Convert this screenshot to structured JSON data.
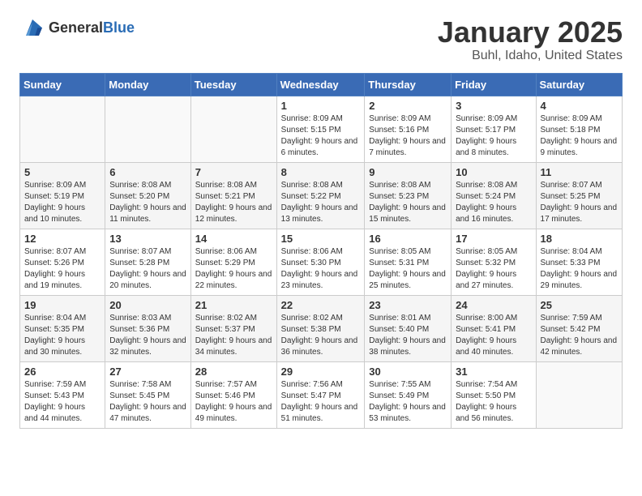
{
  "logo": {
    "general": "General",
    "blue": "Blue"
  },
  "header": {
    "month": "January 2025",
    "location": "Buhl, Idaho, United States"
  },
  "weekdays": [
    "Sunday",
    "Monday",
    "Tuesday",
    "Wednesday",
    "Thursday",
    "Friday",
    "Saturday"
  ],
  "weeks": [
    [
      {
        "day": "",
        "info": ""
      },
      {
        "day": "",
        "info": ""
      },
      {
        "day": "",
        "info": ""
      },
      {
        "day": "1",
        "info": "Sunrise: 8:09 AM\nSunset: 5:15 PM\nDaylight: 9 hours and 6 minutes."
      },
      {
        "day": "2",
        "info": "Sunrise: 8:09 AM\nSunset: 5:16 PM\nDaylight: 9 hours and 7 minutes."
      },
      {
        "day": "3",
        "info": "Sunrise: 8:09 AM\nSunset: 5:17 PM\nDaylight: 9 hours and 8 minutes."
      },
      {
        "day": "4",
        "info": "Sunrise: 8:09 AM\nSunset: 5:18 PM\nDaylight: 9 hours and 9 minutes."
      }
    ],
    [
      {
        "day": "5",
        "info": "Sunrise: 8:09 AM\nSunset: 5:19 PM\nDaylight: 9 hours and 10 minutes."
      },
      {
        "day": "6",
        "info": "Sunrise: 8:08 AM\nSunset: 5:20 PM\nDaylight: 9 hours and 11 minutes."
      },
      {
        "day": "7",
        "info": "Sunrise: 8:08 AM\nSunset: 5:21 PM\nDaylight: 9 hours and 12 minutes."
      },
      {
        "day": "8",
        "info": "Sunrise: 8:08 AM\nSunset: 5:22 PM\nDaylight: 9 hours and 13 minutes."
      },
      {
        "day": "9",
        "info": "Sunrise: 8:08 AM\nSunset: 5:23 PM\nDaylight: 9 hours and 15 minutes."
      },
      {
        "day": "10",
        "info": "Sunrise: 8:08 AM\nSunset: 5:24 PM\nDaylight: 9 hours and 16 minutes."
      },
      {
        "day": "11",
        "info": "Sunrise: 8:07 AM\nSunset: 5:25 PM\nDaylight: 9 hours and 17 minutes."
      }
    ],
    [
      {
        "day": "12",
        "info": "Sunrise: 8:07 AM\nSunset: 5:26 PM\nDaylight: 9 hours and 19 minutes."
      },
      {
        "day": "13",
        "info": "Sunrise: 8:07 AM\nSunset: 5:28 PM\nDaylight: 9 hours and 20 minutes."
      },
      {
        "day": "14",
        "info": "Sunrise: 8:06 AM\nSunset: 5:29 PM\nDaylight: 9 hours and 22 minutes."
      },
      {
        "day": "15",
        "info": "Sunrise: 8:06 AM\nSunset: 5:30 PM\nDaylight: 9 hours and 23 minutes."
      },
      {
        "day": "16",
        "info": "Sunrise: 8:05 AM\nSunset: 5:31 PM\nDaylight: 9 hours and 25 minutes."
      },
      {
        "day": "17",
        "info": "Sunrise: 8:05 AM\nSunset: 5:32 PM\nDaylight: 9 hours and 27 minutes."
      },
      {
        "day": "18",
        "info": "Sunrise: 8:04 AM\nSunset: 5:33 PM\nDaylight: 9 hours and 29 minutes."
      }
    ],
    [
      {
        "day": "19",
        "info": "Sunrise: 8:04 AM\nSunset: 5:35 PM\nDaylight: 9 hours and 30 minutes."
      },
      {
        "day": "20",
        "info": "Sunrise: 8:03 AM\nSunset: 5:36 PM\nDaylight: 9 hours and 32 minutes."
      },
      {
        "day": "21",
        "info": "Sunrise: 8:02 AM\nSunset: 5:37 PM\nDaylight: 9 hours and 34 minutes."
      },
      {
        "day": "22",
        "info": "Sunrise: 8:02 AM\nSunset: 5:38 PM\nDaylight: 9 hours and 36 minutes."
      },
      {
        "day": "23",
        "info": "Sunrise: 8:01 AM\nSunset: 5:40 PM\nDaylight: 9 hours and 38 minutes."
      },
      {
        "day": "24",
        "info": "Sunrise: 8:00 AM\nSunset: 5:41 PM\nDaylight: 9 hours and 40 minutes."
      },
      {
        "day": "25",
        "info": "Sunrise: 7:59 AM\nSunset: 5:42 PM\nDaylight: 9 hours and 42 minutes."
      }
    ],
    [
      {
        "day": "26",
        "info": "Sunrise: 7:59 AM\nSunset: 5:43 PM\nDaylight: 9 hours and 44 minutes."
      },
      {
        "day": "27",
        "info": "Sunrise: 7:58 AM\nSunset: 5:45 PM\nDaylight: 9 hours and 47 minutes."
      },
      {
        "day": "28",
        "info": "Sunrise: 7:57 AM\nSunset: 5:46 PM\nDaylight: 9 hours and 49 minutes."
      },
      {
        "day": "29",
        "info": "Sunrise: 7:56 AM\nSunset: 5:47 PM\nDaylight: 9 hours and 51 minutes."
      },
      {
        "day": "30",
        "info": "Sunrise: 7:55 AM\nSunset: 5:49 PM\nDaylight: 9 hours and 53 minutes."
      },
      {
        "day": "31",
        "info": "Sunrise: 7:54 AM\nSunset: 5:50 PM\nDaylight: 9 hours and 56 minutes."
      },
      {
        "day": "",
        "info": ""
      }
    ]
  ]
}
